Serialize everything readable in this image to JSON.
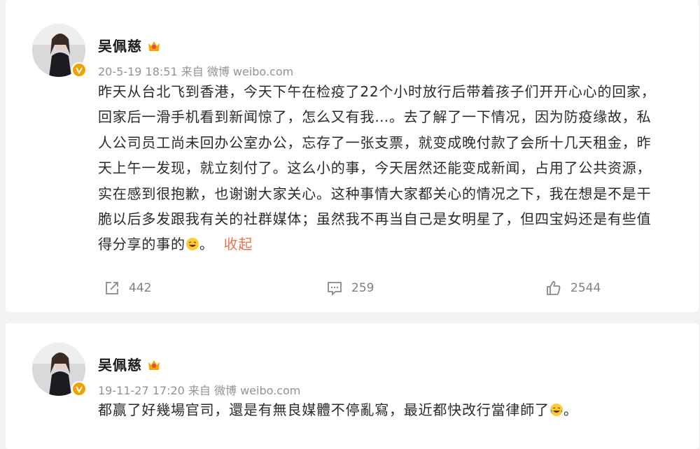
{
  "posts": [
    {
      "author": "吴佩慈",
      "meta": "20-5-19 18:51 来自 微博 weibo.com",
      "lines": [
        "昨天从台北飞到香港，今天下午在检疫了22个小时放行后带着孩子们开开心心的回家，",
        "回家后一滑手机看到新闻惊了，怎么又有我…。去了解了一下情况，因为防疫缘故，私",
        "人公司员工尚未回办公室办公，忘存了一张支票，就变成晚付款了会所十几天租金，昨",
        "天上午一发现，就立刻付了。这么小的事，今天居然还能变成新闻，占用了公共资源，",
        "实在感到很抱歉，也谢谢大家关心。这种事情大家都关心的情况之下，我在想是不是干",
        "脆以后多发跟我有关的社群媒体；虽然我不再当自己是女明星了，但四宝妈还是有些值",
        "得分享的事的"
      ],
      "tail": "。",
      "collapse_label": "收起",
      "repost_count": "442",
      "comment_count": "259",
      "like_count": "2544",
      "icons": {
        "repost": "repost-icon",
        "comment": "comment-icon",
        "like": "like-icon"
      }
    },
    {
      "author": "吴佩慈",
      "meta": "19-11-27 17:20 来自 微博 weibo.com",
      "text": "都赢了好幾場官司，還是有無良媒體不停亂寫，最近都快改行當律師了",
      "tail": "。"
    }
  ],
  "colors": {
    "page_bg": "#f2f2f2",
    "card_bg": "#ffffff",
    "meta_gray": "#939393",
    "link_orange": "#eb7350",
    "verified_gold": "#f0a300"
  }
}
